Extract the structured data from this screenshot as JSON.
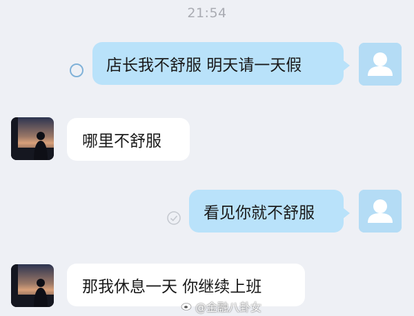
{
  "chat": {
    "timestamp": "21:54",
    "messages": [
      {
        "sender": "me",
        "text": "店长我不舒服 明天请一天假",
        "status": "unread-circle-icon"
      },
      {
        "sender": "them",
        "text": "哪里不舒服"
      },
      {
        "sender": "me",
        "text": "看见你就不舒服",
        "status": "read-check-icon"
      },
      {
        "sender": "them",
        "text": "那我休息一天 你继续上班"
      }
    ]
  },
  "watermark": {
    "icon": "weibo-icon",
    "text": "@金融八卦女"
  },
  "colors": {
    "background": "#eef0f5",
    "my_bubble": "#b9e2fa",
    "their_bubble": "#ffffff",
    "timestamp": "#a9abb2"
  }
}
